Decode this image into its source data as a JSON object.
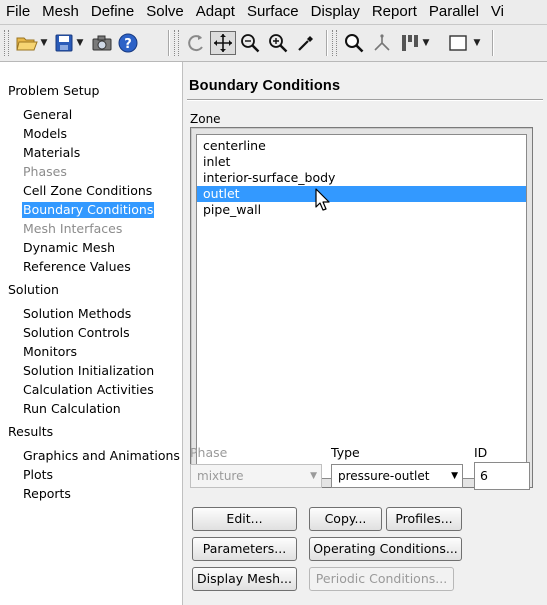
{
  "menubar": {
    "items": [
      "File",
      "Mesh",
      "Define",
      "Solve",
      "Adapt",
      "Surface",
      "Display",
      "Report",
      "Parallel",
      "Vi"
    ]
  },
  "toolbar": {
    "icons": [
      "open-folder-icon",
      "save-icon",
      "camera-icon",
      "help-icon",
      "rotate-icon",
      "pan-icon",
      "zoom-in-icon",
      "zoom-in-plus-icon",
      "probe-icon",
      "zoom-to-fit-icon",
      "compass-icon",
      "layout-icon",
      "window-icon"
    ]
  },
  "tree": {
    "sections": [
      {
        "label": "Problem Setup",
        "items": [
          {
            "label": "General",
            "state": "normal"
          },
          {
            "label": "Models",
            "state": "normal"
          },
          {
            "label": "Materials",
            "state": "normal"
          },
          {
            "label": "Phases",
            "state": "disabled"
          },
          {
            "label": "Cell Zone Conditions",
            "state": "normal"
          },
          {
            "label": "Boundary Conditions",
            "state": "selected"
          },
          {
            "label": "Mesh Interfaces",
            "state": "disabled"
          },
          {
            "label": "Dynamic Mesh",
            "state": "normal"
          },
          {
            "label": "Reference Values",
            "state": "normal"
          }
        ]
      },
      {
        "label": "Solution",
        "items": [
          {
            "label": "Solution Methods",
            "state": "normal"
          },
          {
            "label": "Solution Controls",
            "state": "normal"
          },
          {
            "label": "Monitors",
            "state": "normal"
          },
          {
            "label": "Solution Initialization",
            "state": "normal"
          },
          {
            "label": "Calculation Activities",
            "state": "normal"
          },
          {
            "label": "Run Calculation",
            "state": "normal"
          }
        ]
      },
      {
        "label": "Results",
        "items": [
          {
            "label": "Graphics and Animations",
            "state": "normal"
          },
          {
            "label": "Plots",
            "state": "normal"
          },
          {
            "label": "Reports",
            "state": "normal"
          }
        ]
      }
    ]
  },
  "panel": {
    "title": "Boundary Conditions",
    "zone_label": "Zone",
    "zones": [
      {
        "label": "centerline",
        "selected": false
      },
      {
        "label": "inlet",
        "selected": false
      },
      {
        "label": "interior-surface_body",
        "selected": false
      },
      {
        "label": "outlet",
        "selected": true
      },
      {
        "label": "pipe_wall",
        "selected": false
      }
    ],
    "phase_label": "Phase",
    "phase_value": "mixture",
    "type_label": "Type",
    "type_value": "pressure-outlet",
    "id_label": "ID",
    "id_value": "6",
    "buttons": {
      "edit": "Edit...",
      "copy": "Copy...",
      "profiles": "Profiles...",
      "parameters": "Parameters...",
      "operating_conditions": "Operating Conditions...",
      "display_mesh": "Display Mesh...",
      "periodic_conditions": "Periodic Conditions..."
    }
  },
  "colors": {
    "selection": "#3399ff",
    "panel_bg": "#f0f0f0",
    "disabled_text": "#8c8c8c"
  }
}
